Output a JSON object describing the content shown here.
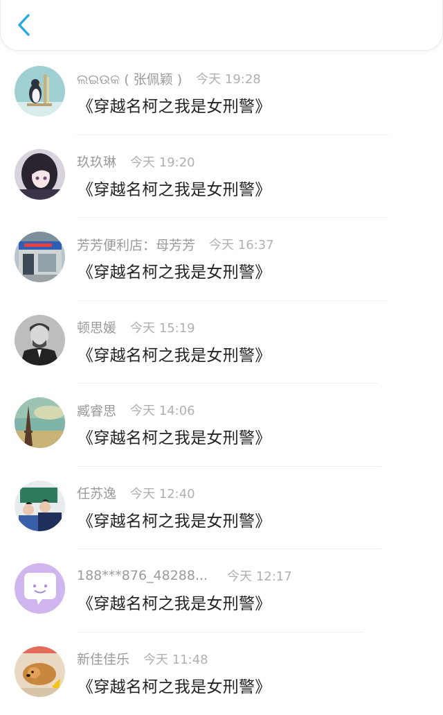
{
  "header": {
    "back_icon": "chevron-left-icon",
    "accent": "#2aa8e0"
  },
  "comments": [
    {
      "user": "ଲଇଉକ ( 张佩颖 )",
      "time": "今天 19:28",
      "text": "《穿越名柯之我是女刑警》",
      "avatar": "penguin-avatar"
    },
    {
      "user": "玖玖琳",
      "time": "今天 19:20",
      "text": "《穿越名柯之我是女刑警》",
      "avatar": "anime-girl-avatar"
    },
    {
      "user": "芳芳便利店：母芳芳",
      "time": "今天 16:37",
      "text": "《穿越名柯之我是女刑警》",
      "avatar": "storefront-avatar"
    },
    {
      "user": "顿思媛",
      "time": "今天 15:19",
      "text": "《穿越名柯之我是女刑警》",
      "avatar": "man-portrait-avatar"
    },
    {
      "user": "臧睿思",
      "time": "今天 14:06",
      "text": "《穿越名柯之我是女刑警》",
      "avatar": "eiffel-tower-avatar"
    },
    {
      "user": "任苏逸",
      "time": "今天 12:40",
      "text": "《穿越名柯之我是女刑警》",
      "avatar": "group-photo-avatar"
    },
    {
      "user": "188***876_48288...",
      "time": "今天 12:17",
      "text": "《穿越名柯之我是女刑警》",
      "avatar": "chat-bubble-avatar"
    },
    {
      "user": "新佳佳乐",
      "time": "今天 11:48",
      "text": "《穿越名柯之我是女刑警》",
      "avatar": "puppy-avatar"
    }
  ]
}
